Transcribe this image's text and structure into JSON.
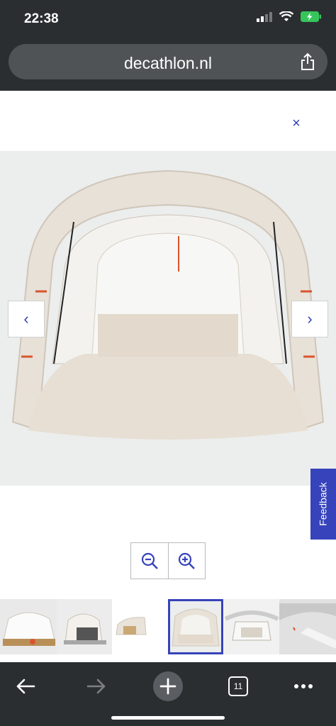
{
  "status": {
    "time": "22:38"
  },
  "browser": {
    "url": "decathlon.nl",
    "tabs_count": "11"
  },
  "gallery": {
    "close_label": "×",
    "prev_label": "‹",
    "next_label": "›",
    "active_thumbnail_index": 3,
    "thumbnail_count": 6
  },
  "feedback": {
    "label": "Feedback"
  },
  "colors": {
    "accent": "#3643ba",
    "chrome": "#2b2e31",
    "tent_fabric": "#e9e2d8",
    "strap": "#d9542e"
  }
}
